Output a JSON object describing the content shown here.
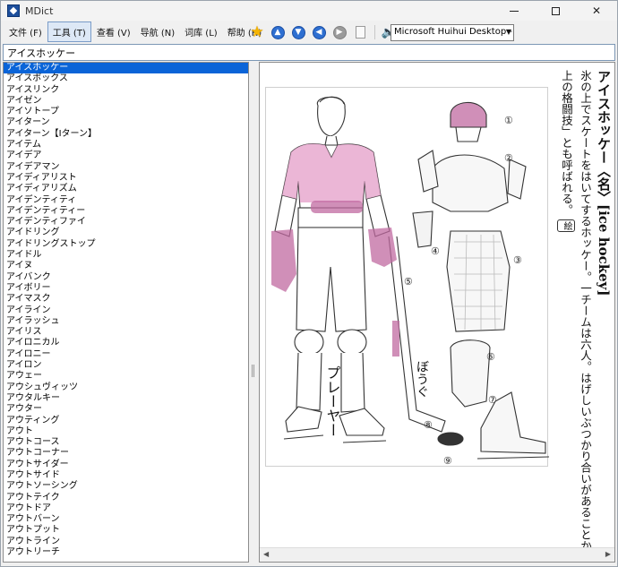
{
  "app": {
    "title": "MDict"
  },
  "menu": [
    {
      "label": "文件 (F)",
      "active": false
    },
    {
      "label": "工具 (T)",
      "active": true
    },
    {
      "label": "查看 (V)",
      "active": false
    },
    {
      "label": "导航 (N)",
      "active": false
    },
    {
      "label": "词库 (L)",
      "active": false
    },
    {
      "label": "帮助 (H)",
      "active": false
    }
  ],
  "toolbar": {
    "icons": [
      "star-icon",
      "arrow-up-icon",
      "arrow-down-icon",
      "arrow-back-icon",
      "arrow-forward-icon",
      "document-icon",
      "speaker-icon"
    ],
    "voice": "Microsoft Huihui Desktop - C"
  },
  "search": {
    "value": "アイスホッケー"
  },
  "word_list": [
    "アイスホッケー",
    "アイスボックス",
    "アイスリンク",
    "アイゼン",
    "アイソトープ",
    "アイターン",
    "アイターン【Iターン】",
    "アイテム",
    "アイデア",
    "アイデアマン",
    "アイディアリスト",
    "アイディアリズム",
    "アイデンティティ",
    "アイデンティティー",
    "アイデンティファイ",
    "アイドリング",
    "アイドリングストップ",
    "アイドル",
    "アイヌ",
    "アイバンク",
    "アイボリー",
    "アイマスク",
    "アイライン",
    "アイラッシュ",
    "アイリス",
    "アイロニカル",
    "アイロニー",
    "アイロン",
    "アウェー",
    "アウシュヴィッツ",
    "アウタルキー",
    "アウター",
    "アウティング",
    "アウト",
    "アウトコース",
    "アウトコーナー",
    "アウトサイダー",
    "アウトサイド",
    "アウトソーシング",
    "アウトテイク",
    "アウトドア",
    "アウトバーン",
    "アウトプット",
    "アウトライン",
    "アウトリーチ"
  ],
  "selected_index": 0,
  "entry": {
    "headword": "アイスホッケー",
    "pos": "〈名〉",
    "english": "[ice hockey]",
    "definition": "氷の上でスケートをはいてするホッケー。一チームは六人。はげしいぶつかり合いがあることから、「氷",
    "definition_cont": "上の格闘技」とも呼ばれる。",
    "figure_mark": "絵"
  },
  "illustration": {
    "player_label": "プレーヤー",
    "gear_label": "ぼうぐ",
    "numbers": [
      "①",
      "②",
      "③",
      "④",
      "⑤",
      "⑥",
      "⑦",
      "⑧",
      "⑨"
    ],
    "accent_color": "#e7a9cf",
    "accent_dark": "#c06aa0"
  },
  "colors": {
    "selection": "#0a64d8",
    "toolbar_blue": "#2e6fd1"
  }
}
